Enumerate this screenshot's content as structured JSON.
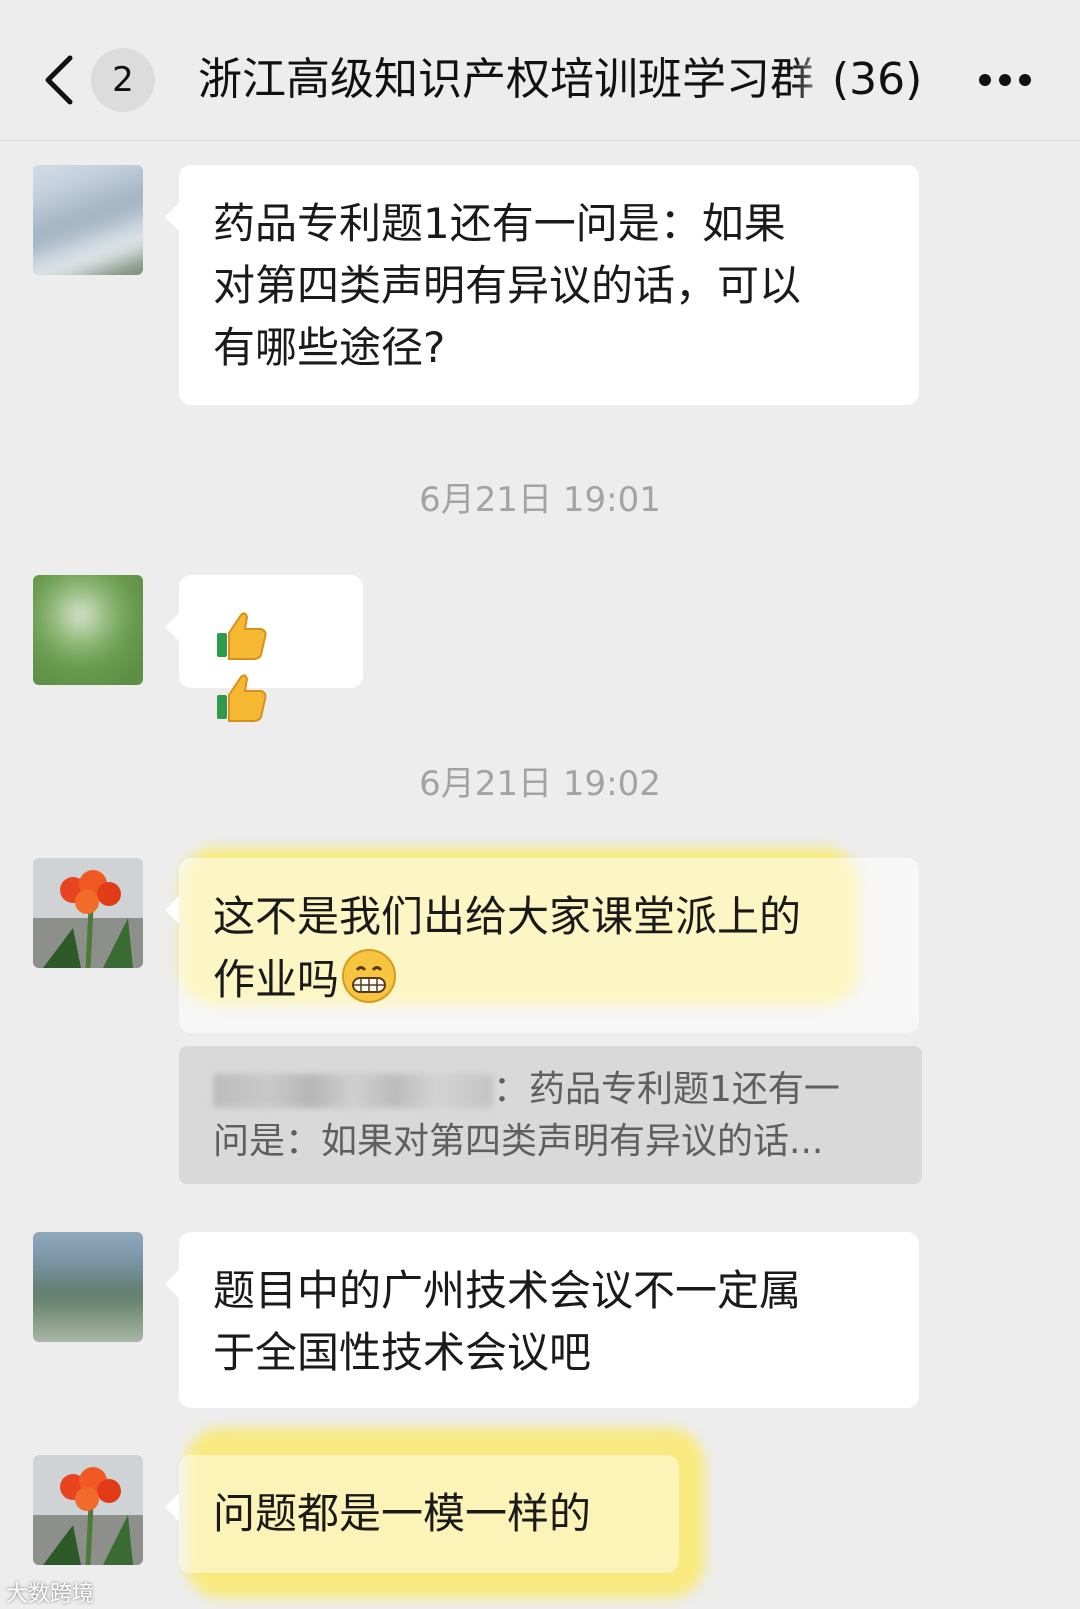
{
  "header": {
    "unread_count": "2",
    "title": "浙江高级知识产权培训班学习群",
    "member_count": "(36)"
  },
  "messages": [
    {
      "text_lines": [
        "药品专利题1还有一问是：如果",
        "对第四类声明有异议的话，可以",
        "有哪些途径?"
      ]
    },
    {
      "emoji": [
        "thumbs-up",
        "thumbs-up"
      ]
    },
    {
      "text_lines": [
        "这不是我们出给大家课堂派上的",
        "作业吗"
      ],
      "trailing_emoji": "grinning-face",
      "quote": {
        "line1": "：药品专利题1还有一",
        "line2": "问是：如果对第四类声明有异议的话..."
      }
    },
    {
      "text_lines": [
        "题目中的广州技术会议不一定属",
        "于全国性技术会议吧"
      ]
    },
    {
      "text_lines": [
        "问题都是一模一样的"
      ]
    }
  ],
  "timestamps": [
    "6月21日 19:01",
    "6月21日 19:02"
  ],
  "watermark": "大数跨境",
  "colors": {
    "background": "#ededed",
    "bubble": "#ffffff",
    "highlight": "#ffe83c",
    "quote_bg": "#d9d9d9"
  }
}
